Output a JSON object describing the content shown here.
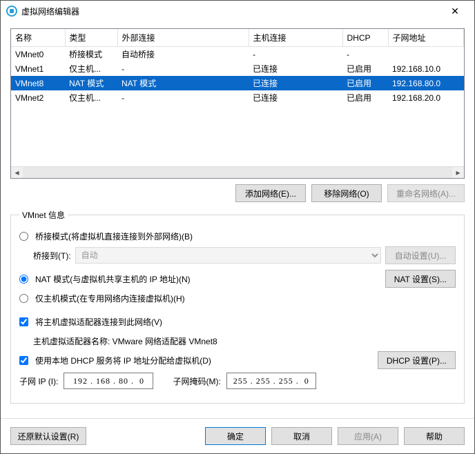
{
  "window": {
    "title": "虚拟网络编辑器"
  },
  "table": {
    "headers": [
      "名称",
      "类型",
      "外部连接",
      "主机连接",
      "DHCP",
      "子网地址"
    ],
    "rows": [
      {
        "name": "VMnet0",
        "type": "桥接模式",
        "ext": "自动桥接",
        "host": "-",
        "dhcp": "-",
        "subnet": "",
        "selected": false
      },
      {
        "name": "VMnet1",
        "type": "仅主机...",
        "ext": "-",
        "host": "已连接",
        "dhcp": "已启用",
        "subnet": "192.168.10.0",
        "selected": false
      },
      {
        "name": "VMnet8",
        "type": "NAT 模式",
        "ext": "NAT 模式",
        "host": "已连接",
        "dhcp": "已启用",
        "subnet": "192.168.80.0",
        "selected": true
      },
      {
        "name": "VMnet2",
        "type": "仅主机...",
        "ext": "-",
        "host": "已连接",
        "dhcp": "已启用",
        "subnet": "192.168.20.0",
        "selected": false
      }
    ]
  },
  "buttons": {
    "add": "添加网络(E)...",
    "remove": "移除网络(O)",
    "rename": "重命名网络(A)..."
  },
  "group": {
    "legend": "VMnet 信息",
    "bridged": "桥接模式(将虚拟机直接连接到外部网络)(B)",
    "bridgeToLabel": "桥接到(T):",
    "bridgeToValue": "自动",
    "autoSettings": "自动设置(U)...",
    "nat": "NAT 模式(与虚拟机共享主机的 IP 地址)(N)",
    "natSettings": "NAT 设置(S)...",
    "hostonly": "仅主机模式(在专用网络内连接虚拟机)(H)",
    "connectAdapter": "将主机虚拟适配器连接到此网络(V)",
    "adapterName": "主机虚拟适配器名称: VMware 网络适配器 VMnet8",
    "useDhcp": "使用本地 DHCP 服务将 IP 地址分配给虚拟机(D)",
    "dhcpSettings": "DHCP 设置(P)...",
    "subnetIpLabel": "子网 IP (I):",
    "subnetIpValue": "192 . 168 . 80 .  0",
    "subnetMaskLabel": "子网掩码(M):",
    "subnetMaskValue": "255 . 255 . 255 .  0"
  },
  "footer": {
    "restore": "还原默认设置(R)",
    "ok": "确定",
    "cancel": "取消",
    "apply": "应用(A)",
    "help": "帮助"
  }
}
